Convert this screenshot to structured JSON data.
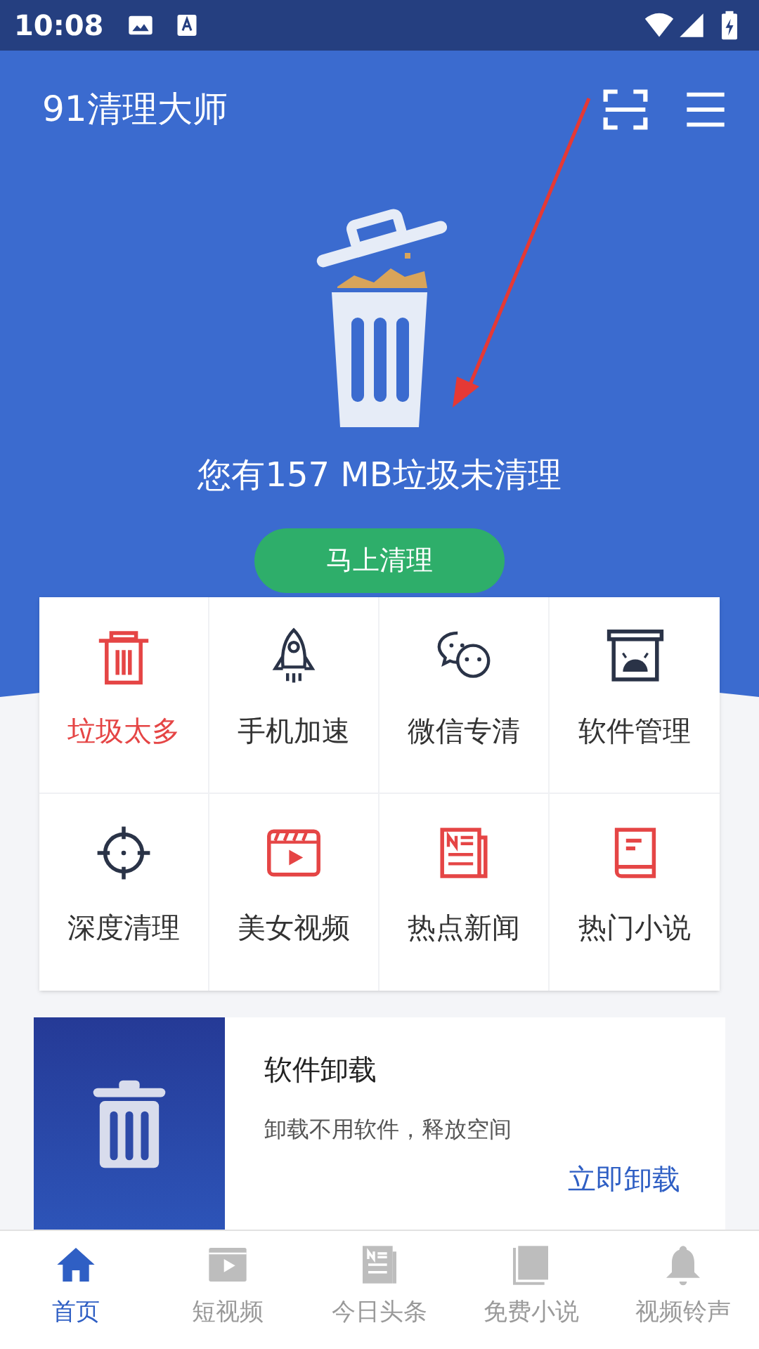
{
  "status_bar": {
    "time": "10:08"
  },
  "header": {
    "title": "91清理大师"
  },
  "summary": {
    "prefix": "您有",
    "amount": "157 MB",
    "suffix": "垃圾未清理",
    "button": "马上清理"
  },
  "tools": [
    {
      "kind": "trash",
      "label": "垃圾太多",
      "color": "#e54545",
      "highlighted": true
    },
    {
      "kind": "rocket",
      "label": "手机加速",
      "color": "#2a3347",
      "highlighted": false
    },
    {
      "kind": "chat",
      "label": "微信专清",
      "color": "#2a3347",
      "highlighted": false
    },
    {
      "kind": "box",
      "label": "软件管理",
      "color": "#2a3347",
      "highlighted": false
    },
    {
      "kind": "target",
      "label": "深度清理",
      "color": "#2a3347",
      "highlighted": false
    },
    {
      "kind": "film",
      "label": "美女视频",
      "color": "#e54545",
      "highlighted": false
    },
    {
      "kind": "news",
      "label": "热点新闻",
      "color": "#e54545",
      "highlighted": false
    },
    {
      "kind": "book",
      "label": "热门小说",
      "color": "#e54545",
      "highlighted": false
    }
  ],
  "uninstall_card": {
    "title": "软件卸载",
    "description": "卸载不用软件，释放空间",
    "action": "立即卸载"
  },
  "bottom_nav": [
    {
      "kind": "home",
      "label": "首页",
      "selected": true
    },
    {
      "kind": "film",
      "label": "短视频",
      "selected": false
    },
    {
      "kind": "news",
      "label": "今日头条",
      "selected": false
    },
    {
      "kind": "book",
      "label": "免费小说",
      "selected": false
    },
    {
      "kind": "bell",
      "label": "视频铃声",
      "selected": false
    }
  ]
}
